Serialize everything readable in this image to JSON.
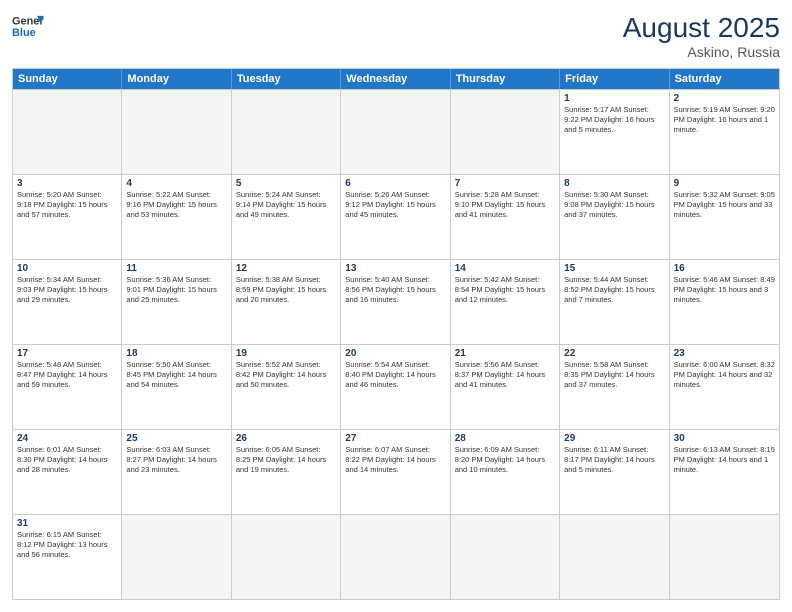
{
  "header": {
    "logo_general": "General",
    "logo_blue": "Blue",
    "month_year": "August 2025",
    "location": "Askino, Russia"
  },
  "days_of_week": [
    "Sunday",
    "Monday",
    "Tuesday",
    "Wednesday",
    "Thursday",
    "Friday",
    "Saturday"
  ],
  "weeks": [
    [
      {
        "day": "",
        "data": ""
      },
      {
        "day": "",
        "data": ""
      },
      {
        "day": "",
        "data": ""
      },
      {
        "day": "",
        "data": ""
      },
      {
        "day": "",
        "data": ""
      },
      {
        "day": "1",
        "data": "Sunrise: 5:17 AM\nSunset: 9:22 PM\nDaylight: 16 hours and 5 minutes."
      },
      {
        "day": "2",
        "data": "Sunrise: 5:19 AM\nSunset: 9:20 PM\nDaylight: 16 hours and 1 minute."
      }
    ],
    [
      {
        "day": "3",
        "data": "Sunrise: 5:20 AM\nSunset: 9:18 PM\nDaylight: 15 hours and 57 minutes."
      },
      {
        "day": "4",
        "data": "Sunrise: 5:22 AM\nSunset: 9:16 PM\nDaylight: 15 hours and 53 minutes."
      },
      {
        "day": "5",
        "data": "Sunrise: 5:24 AM\nSunset: 9:14 PM\nDaylight: 15 hours and 49 minutes."
      },
      {
        "day": "6",
        "data": "Sunrise: 5:26 AM\nSunset: 9:12 PM\nDaylight: 15 hours and 45 minutes."
      },
      {
        "day": "7",
        "data": "Sunrise: 5:28 AM\nSunset: 9:10 PM\nDaylight: 15 hours and 41 minutes."
      },
      {
        "day": "8",
        "data": "Sunrise: 5:30 AM\nSunset: 9:08 PM\nDaylight: 15 hours and 37 minutes."
      },
      {
        "day": "9",
        "data": "Sunrise: 5:32 AM\nSunset: 9:05 PM\nDaylight: 15 hours and 33 minutes."
      }
    ],
    [
      {
        "day": "10",
        "data": "Sunrise: 5:34 AM\nSunset: 9:03 PM\nDaylight: 15 hours and 29 minutes."
      },
      {
        "day": "11",
        "data": "Sunrise: 5:36 AM\nSunset: 9:01 PM\nDaylight: 15 hours and 25 minutes."
      },
      {
        "day": "12",
        "data": "Sunrise: 5:38 AM\nSunset: 8:59 PM\nDaylight: 15 hours and 20 minutes."
      },
      {
        "day": "13",
        "data": "Sunrise: 5:40 AM\nSunset: 8:56 PM\nDaylight: 15 hours and 16 minutes."
      },
      {
        "day": "14",
        "data": "Sunrise: 5:42 AM\nSunset: 8:54 PM\nDaylight: 15 hours and 12 minutes."
      },
      {
        "day": "15",
        "data": "Sunrise: 5:44 AM\nSunset: 8:52 PM\nDaylight: 15 hours and 7 minutes."
      },
      {
        "day": "16",
        "data": "Sunrise: 5:46 AM\nSunset: 8:49 PM\nDaylight: 15 hours and 3 minutes."
      }
    ],
    [
      {
        "day": "17",
        "data": "Sunrise: 5:48 AM\nSunset: 8:47 PM\nDaylight: 14 hours and 59 minutes."
      },
      {
        "day": "18",
        "data": "Sunrise: 5:50 AM\nSunset: 8:45 PM\nDaylight: 14 hours and 54 minutes."
      },
      {
        "day": "19",
        "data": "Sunrise: 5:52 AM\nSunset: 8:42 PM\nDaylight: 14 hours and 50 minutes."
      },
      {
        "day": "20",
        "data": "Sunrise: 5:54 AM\nSunset: 8:40 PM\nDaylight: 14 hours and 46 minutes."
      },
      {
        "day": "21",
        "data": "Sunrise: 5:56 AM\nSunset: 8:37 PM\nDaylight: 14 hours and 41 minutes."
      },
      {
        "day": "22",
        "data": "Sunrise: 5:58 AM\nSunset: 8:35 PM\nDaylight: 14 hours and 37 minutes."
      },
      {
        "day": "23",
        "data": "Sunrise: 6:00 AM\nSunset: 8:32 PM\nDaylight: 14 hours and 32 minutes."
      }
    ],
    [
      {
        "day": "24",
        "data": "Sunrise: 6:01 AM\nSunset: 8:30 PM\nDaylight: 14 hours and 28 minutes."
      },
      {
        "day": "25",
        "data": "Sunrise: 6:03 AM\nSunset: 8:27 PM\nDaylight: 14 hours and 23 minutes."
      },
      {
        "day": "26",
        "data": "Sunrise: 6:05 AM\nSunset: 8:25 PM\nDaylight: 14 hours and 19 minutes."
      },
      {
        "day": "27",
        "data": "Sunrise: 6:07 AM\nSunset: 8:22 PM\nDaylight: 14 hours and 14 minutes."
      },
      {
        "day": "28",
        "data": "Sunrise: 6:09 AM\nSunset: 8:20 PM\nDaylight: 14 hours and 10 minutes."
      },
      {
        "day": "29",
        "data": "Sunrise: 6:11 AM\nSunset: 8:17 PM\nDaylight: 14 hours and 5 minutes."
      },
      {
        "day": "30",
        "data": "Sunrise: 6:13 AM\nSunset: 8:15 PM\nDaylight: 14 hours and 1 minute."
      }
    ],
    [
      {
        "day": "31",
        "data": "Sunrise: 6:15 AM\nSunset: 8:12 PM\nDaylight: 13 hours and 56 minutes."
      },
      {
        "day": "",
        "data": ""
      },
      {
        "day": "",
        "data": ""
      },
      {
        "day": "",
        "data": ""
      },
      {
        "day": "",
        "data": ""
      },
      {
        "day": "",
        "data": ""
      },
      {
        "day": "",
        "data": ""
      }
    ]
  ]
}
